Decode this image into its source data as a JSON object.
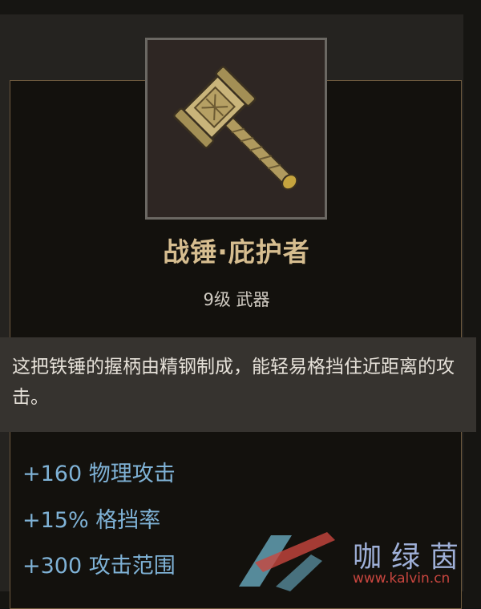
{
  "item": {
    "name": "战锤·庇护者",
    "meta": "9级 武器",
    "icon": "war-hammer-icon",
    "description": "这把铁锤的握柄由精钢制成，能轻易格挡住近距离的攻击。"
  },
  "stats": [
    {
      "label": "+160 物理攻击"
    },
    {
      "label": "+15% 格挡率"
    },
    {
      "label": "+300 攻击范围"
    }
  ],
  "watermark": {
    "text": "咖绿茵",
    "url": "www.kalvin.cn"
  },
  "colors": {
    "name": "#d6bd8f",
    "stat": "#7fb2d6",
    "border": "#6e5a3e",
    "description_bg": "#36332f"
  }
}
